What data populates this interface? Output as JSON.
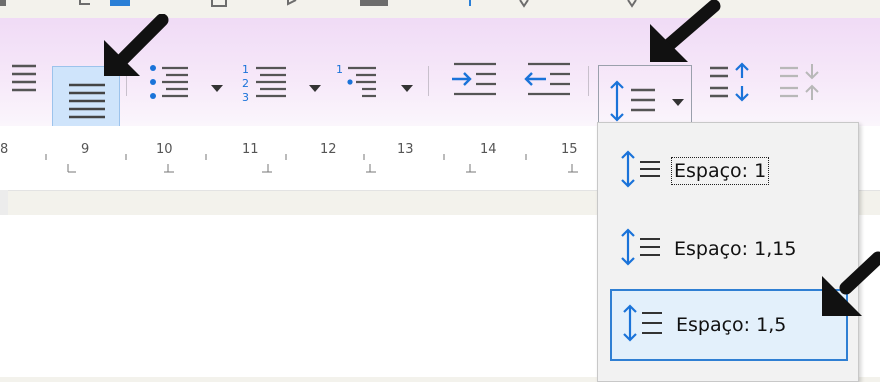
{
  "toolbar": {
    "align_justify": "justify-align-icon",
    "unordered_list": "unordered-list-icon",
    "ordered_list": "ordered-list-icon",
    "outline_list": "outline-list-icon",
    "increase_indent": "increase-indent-icon",
    "decrease_indent": "decrease-indent-icon",
    "line_spacing": "line-spacing-icon",
    "increase_paragraph_spacing": "increase-paragraph-spacing-icon",
    "decrease_paragraph_spacing": "decrease-paragraph-spacing-icon"
  },
  "ruler": {
    "numbers": [
      "8",
      "9",
      "10",
      "11",
      "12",
      "13",
      "14",
      "15"
    ]
  },
  "menu": {
    "items": [
      {
        "label": "Espaço: 1"
      },
      {
        "label": "Espaço: 1,15"
      },
      {
        "label": "Espaço: 1,5"
      }
    ],
    "selected_index": 2
  },
  "colors": {
    "toolbar_bg": "#f0dbf6",
    "selection_border": "#2f7fd3",
    "selection_bg": "#e3f0fb",
    "icon_accent": "#1a73d9"
  }
}
